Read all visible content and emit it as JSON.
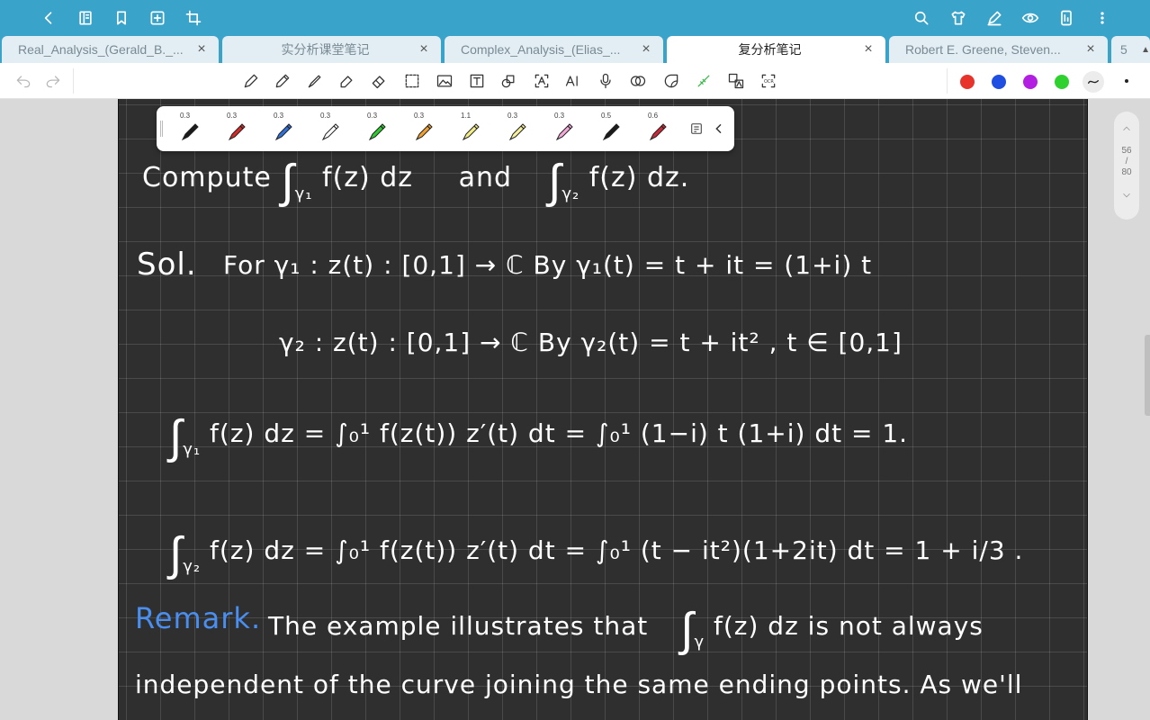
{
  "tabs": [
    {
      "label": "Real_Analysis_(Gerald_B._...",
      "active": false
    },
    {
      "label": "实分析课堂笔记",
      "active": false
    },
    {
      "label": "Complex_Analysis_(Elias_...",
      "active": false
    },
    {
      "label": "复分析笔记",
      "active": true
    },
    {
      "label": "Robert E. Greene, Steven...",
      "active": false
    }
  ],
  "tab_overflow": "5",
  "pens": [
    {
      "width": "0.3",
      "color": "#1a1a1a"
    },
    {
      "width": "0.3",
      "color": "#d42a2a"
    },
    {
      "width": "0.3",
      "color": "#2f6fd8"
    },
    {
      "width": "0.3",
      "color": "#ffffff"
    },
    {
      "width": "0.3",
      "color": "#2fcb2f"
    },
    {
      "width": "0.3",
      "color": "#f0a030"
    },
    {
      "width": "1.1",
      "color": "#f3ef86"
    },
    {
      "width": "0.3",
      "color": "#f6f19a"
    },
    {
      "width": "0.3",
      "color": "#f3a8d8"
    },
    {
      "width": "0.5",
      "color": "#1a1a1a"
    },
    {
      "width": "0.6",
      "color": "#c92a3a"
    }
  ],
  "colors": [
    "#e8332a",
    "#1f4fe0",
    "#b21fe0",
    "#2fd12f"
  ],
  "pager": {
    "current": "56",
    "sep": "/",
    "total": "80"
  },
  "notes": {
    "l1a": "Compute ",
    "l1b": "f(z) dz",
    "l1c": "and",
    "l1d": "f(z) dz.",
    "sol": "Sol.",
    "l2": "For γ₁ :   z(t) : [0,1] → ℂ   By  γ₁(t) = t + it = (1+i) t",
    "l3": "γ₂ :   z(t) : [0,1] → ℂ   By  γ₂(t) = t + it² ,  t ∈ [0,1]",
    "l4": "f(z) dz = ∫₀¹ f(z(t)) z′(t) dt = ∫₀¹ (1−i) t (1+i) dt = 1.",
    "l5": "f(z) dz = ∫₀¹ f(z(t)) z′(t) dt = ∫₀¹ (t − it²)(1+2it) dt = 1 + i/3 .",
    "remark": "Remark.",
    "l6": "The  example  illustrates  that",
    "l6b": "f(z) dz  is  not  always",
    "l7": "independent  of  the  curve  joining  the  same  ending  points.   As we'll"
  }
}
